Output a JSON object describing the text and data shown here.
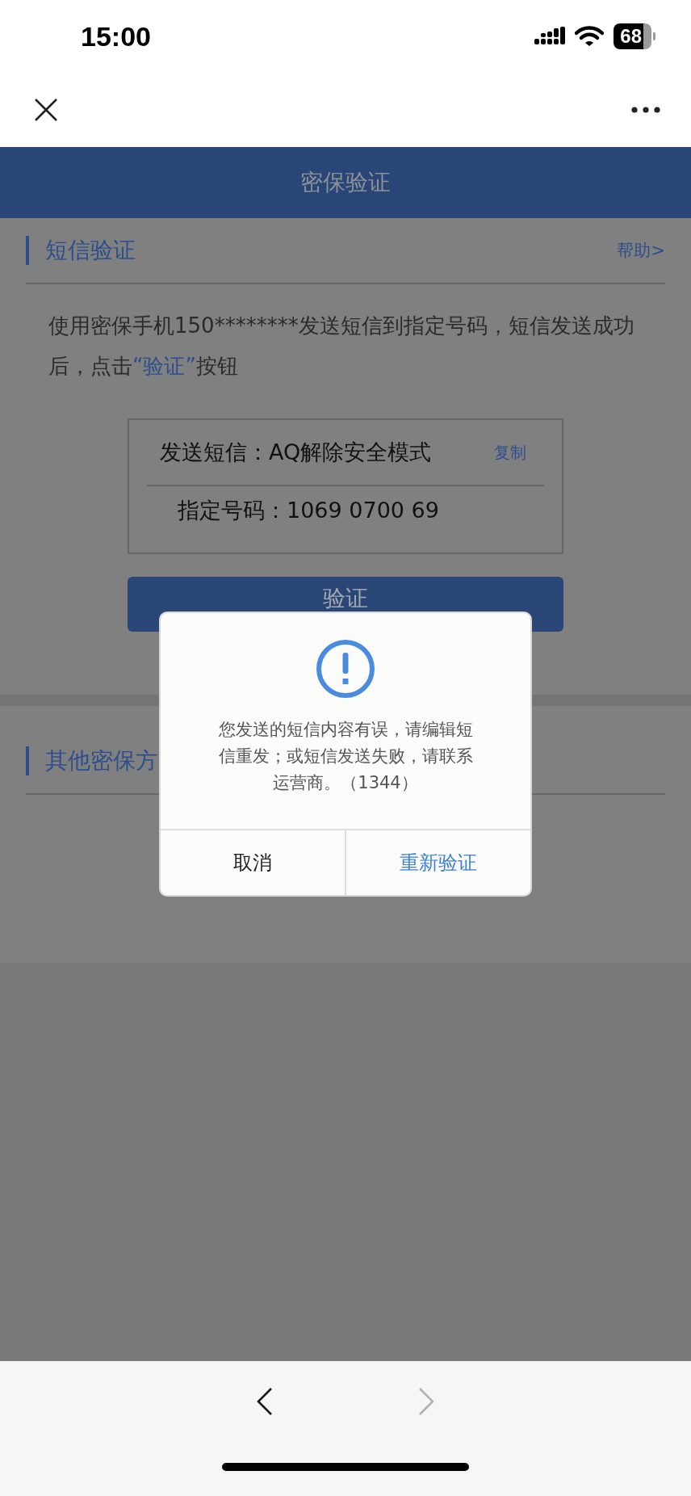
{
  "status_bar": {
    "time": "15:00",
    "battery": "68"
  },
  "header": {
    "title": "密保验证"
  },
  "sms_section": {
    "title": "短信验证",
    "help_link": "帮助>",
    "instruction": [
      {
        "kind": "plain",
        "text": "使用密保手机150********发送短信到指定号码，短信发送成功后，点击"
      },
      {
        "kind": "highlight",
        "text": "“验证”"
      },
      {
        "kind": "plain",
        "text": "按钮"
      }
    ],
    "sms_box": {
      "message": "发送短信：AQ解除安全模式",
      "copy_link": "复制",
      "number": "指定号码：1069 0700 69"
    },
    "verify_button": "验证"
  },
  "other_section": {
    "title": "其他密保方"
  },
  "dialog": {
    "message": "您发送的短信内容有误，请编辑短信重发；或短信发送失败，请联系运营商。（1344）",
    "buttons": [
      {
        "kind": "cancel",
        "label": "取消"
      },
      {
        "kind": "confirm",
        "label": "重新验证"
      }
    ]
  },
  "browser_bar": {
    "back": {
      "disabled": false
    },
    "forward": {
      "disabled": true
    }
  }
}
